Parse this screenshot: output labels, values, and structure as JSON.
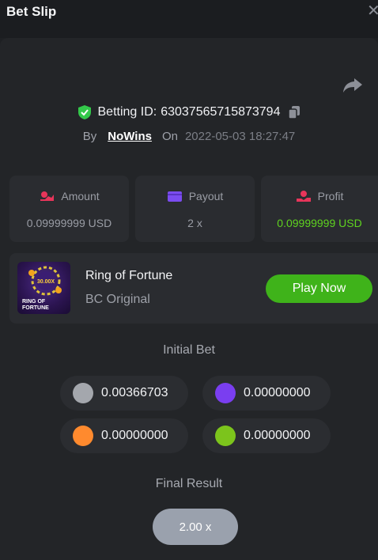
{
  "header": {
    "title": "Bet Slip",
    "close_glyph": "✕"
  },
  "bet": {
    "id_label": "Betting ID:",
    "id_value": "63037565715873794",
    "by_label": "By",
    "user": "NoWins",
    "on_label": "On",
    "date": "2022-05-03 18:27:47"
  },
  "stats": {
    "amount": {
      "label": "Amount",
      "value": "0.09999999 USD",
      "icon": "amount-icon",
      "icon_color": "#e8355a"
    },
    "payout": {
      "label": "Payout",
      "value": "2 x",
      "icon": "wallet-icon",
      "icon_color": "#7b4cf0"
    },
    "profit": {
      "label": "Profit",
      "value": "0.09999999 USD",
      "icon": "profit-icon",
      "icon_color": "#e8355a",
      "value_color": "#5fd31f"
    }
  },
  "game": {
    "name": "Ring of Fortune",
    "provider": "BC Original",
    "play_label": "Play Now",
    "thumb_text_1": "RING OF",
    "thumb_text_2": "FORTUNE",
    "thumb_badge": "30.00X"
  },
  "initial_bet": {
    "title": "Initial Bet",
    "coins": [
      {
        "color": "#a4a7ad",
        "amount": "0.00366703"
      },
      {
        "color": "#7a3ef0",
        "amount": "0.00000000"
      },
      {
        "color": "#ff8a2e",
        "amount": "0.00000000"
      },
      {
        "color": "#7cc41c",
        "amount": "0.00000000"
      }
    ]
  },
  "final_result": {
    "title": "Final Result",
    "value": "2.00 x"
  },
  "colors": {
    "accent_green": "#3fb31a",
    "shield_green": "#33c84a"
  }
}
